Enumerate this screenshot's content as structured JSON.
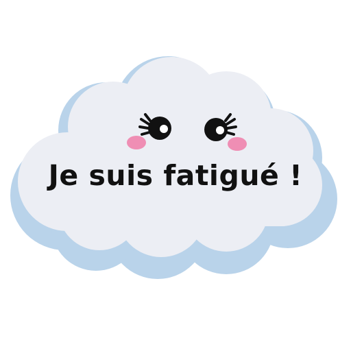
{
  "sticker": {
    "message": "Je suis fatigué !"
  },
  "colors": {
    "background": "#ffffff",
    "cloud_fill": "#eceef4",
    "cloud_shadow": "#b9d3ea",
    "text": "#111111",
    "eye": "#111111",
    "blush": "#ef8eb4"
  },
  "icons": {
    "cloud": "cloud-icon",
    "eyes": "cartoon-eye-icon",
    "blush": "blush-cheek-icon"
  }
}
